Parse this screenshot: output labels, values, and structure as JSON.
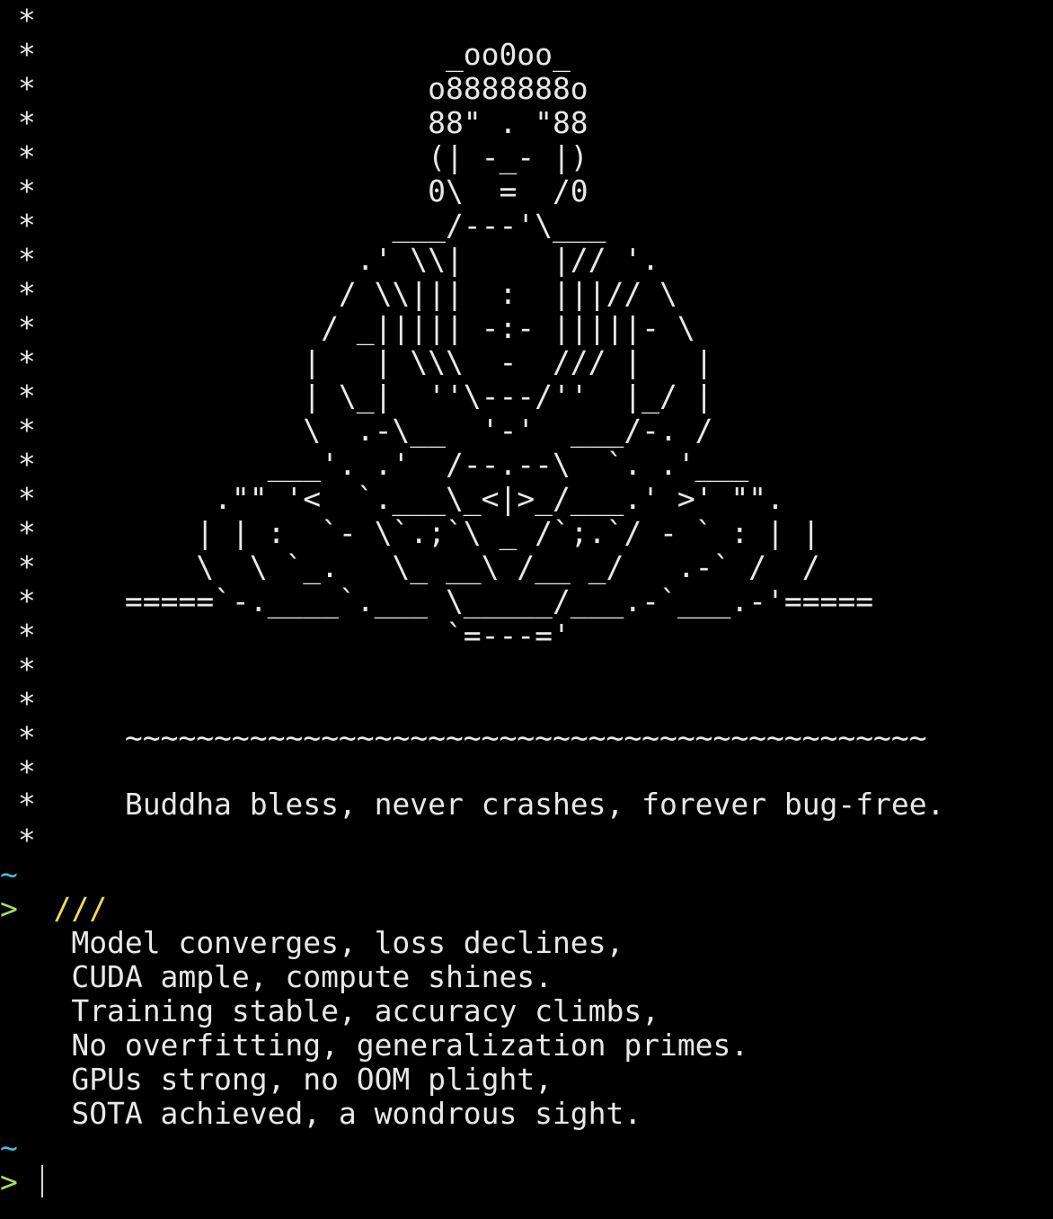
{
  "terminal": {
    "banner_lines": [
      " *",
      " *                       _oo0oo_",
      " *                      o8888888o",
      " *                      88\" . \"88",
      " *                      (| -_- |)",
      " *                      0\\  =  /0",
      " *                    ___/---'\\___",
      " *                  .' \\\\|     |// '.",
      " *                 / \\\\|||  :  |||// \\",
      " *                / _||||| -:- |||||- \\",
      " *               |   | \\\\\\  -  /// |   |",
      " *               | \\_|  ''\\---/''  |_/ |",
      " *               \\  .-\\__  '-'  ___/-. /",
      " *             ___'. .'  /--.--\\  `. .'___",
      " *          .\"\" '<  `.___\\_<|>_/___.' >' \"\".",
      " *         | | :  `- \\`.;`\\ _ /`;.`/ - ` : | |",
      " *         \\  \\ `_.   \\_ __\\ /__ _/   .-` /  /",
      " *     =====`-.____`.___ \\_____/___.-`___.-'=====",
      " *                       `=---='",
      " *",
      " *",
      " *     ~~~~~~~~~~~~~~~~~~~~~~~~~~~~~~~~~~~~~~~~~~~~~",
      " *",
      " *     Buddha bless, never crashes, forever bug-free.",
      " *"
    ],
    "tilde_1": "~",
    "prompt_1": ">",
    "slashes": "///",
    "poem_lines": [
      "    Model converges, loss declines,",
      "    CUDA ample, compute shines.",
      "    Training stable, accuracy climbs,",
      "    No overfitting, generalization primes.",
      "    GPUs strong, no OOM plight,",
      "    SOTA achieved, a wondrous sight."
    ],
    "tilde_2": "~",
    "prompt_2": ">",
    "colors": {
      "background": "#000000",
      "text": "#e8e8e8",
      "tilde": "#3fc3d8",
      "prompt": "#a6e05a",
      "slashes": "#f2df4a"
    }
  }
}
